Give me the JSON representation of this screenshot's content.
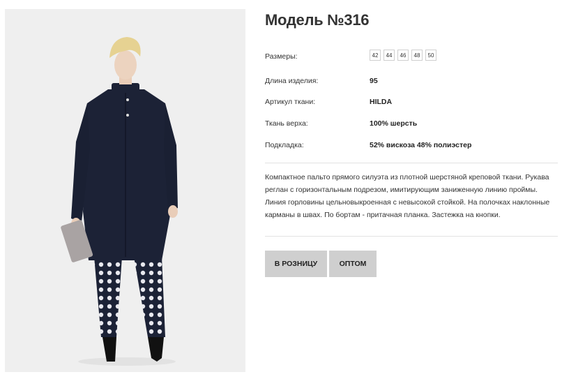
{
  "product": {
    "title": "Модель №316",
    "photo_alt": "Model wearing a dark navy coat with polka-dot trousers"
  },
  "specs": {
    "sizes_label": "Размеры:",
    "sizes": [
      "42",
      "44",
      "46",
      "48",
      "50"
    ],
    "length_label": "Длина изделия:",
    "length_value": "95",
    "article_label": "Артикул ткани:",
    "article_value": "HILDA",
    "top_fabric_label": "Ткань верха:",
    "top_fabric_value": "100% шерсть",
    "lining_label": "Подкладка:",
    "lining_value": "52% вискоза 48% полиэстер"
  },
  "description": "Компактное пальто прямого силуэта из плотной шерстяной креповой ткани. Рукава реглан с горизонтальным подрезом, имитирующим заниженную линию проймы. Линия горловины цельновыкроенная с невысокой стойкой. На полочках наклонные карманы в швах. По бортам - притачная планка. Застежка на кнопки.",
  "buttons": {
    "retail": "В РОЗНИЦУ",
    "wholesale": "ОПТОМ"
  },
  "colors": {
    "coat": "#1c2236",
    "button_bg": "#cfcfcf",
    "photo_bg": "#efefef"
  }
}
